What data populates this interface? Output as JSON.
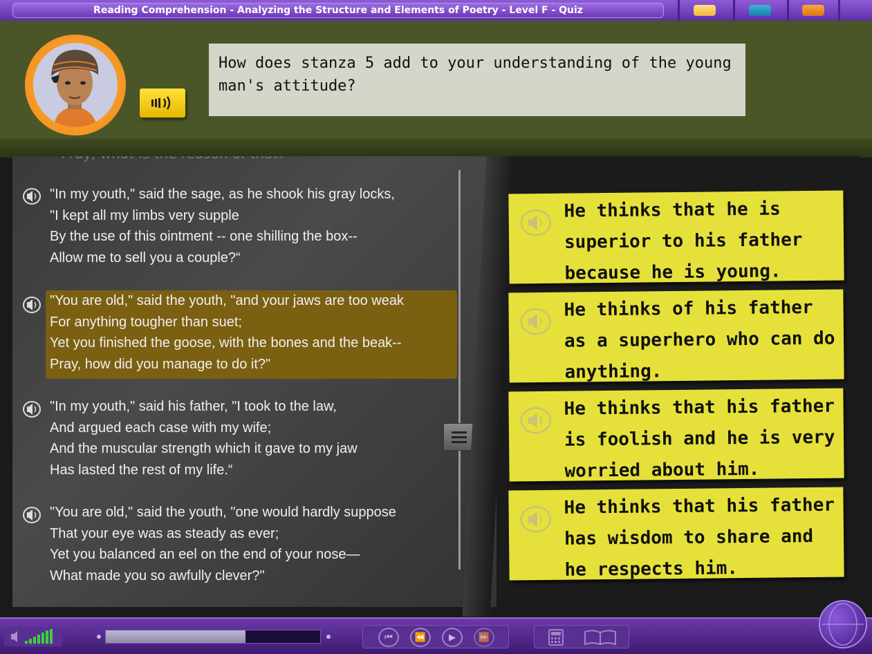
{
  "window": {
    "title": "Reading Comprehension - Analyzing the Structure and Elements of Poetry - Level  F - Quiz"
  },
  "question": {
    "text": "How does stanza 5 add to your understanding of the young man's attitude?"
  },
  "poem": {
    "faded_line": "Pray, what is the reason of that?",
    "stanzas": [
      {
        "lines": [
          "\"In my youth,\" said the sage, as he shook his gray locks,",
          "\"I kept all my limbs very supple",
          "By the use of this ointment -- one shilling the box--",
          "Allow me to sell you a couple?“"
        ],
        "highlighted": false
      },
      {
        "lines": [
          "\"You are old,\" said the youth, \"and your jaws are too weak",
          "For anything tougher than suet;",
          "Yet you finished the goose, with the bones and the beak--",
          "Pray, how did you manage to do it?\""
        ],
        "highlighted": true
      },
      {
        "lines": [
          "\"In my youth,\" said his father, \"I took to the law,",
          "And argued each case with my wife;",
          "And the muscular strength which it gave to my jaw",
          "Has lasted the rest of my life.“"
        ],
        "highlighted": false
      },
      {
        "lines": [
          "\"You are old,\" said the youth, \"one would hardly suppose",
          "That your eye was as steady as ever;",
          "Yet you balanced an eel on the end of your nose—",
          "What made you so awfully clever?\""
        ],
        "highlighted": false
      }
    ]
  },
  "answers": [
    {
      "text": "He thinks that he is superior to his father because he is young."
    },
    {
      "text": "He thinks of his father as a superhero who can do anything."
    },
    {
      "text": "He thinks that his father is foolish and he is very worried about him."
    },
    {
      "text": "He thinks that his father has wisdom to share and he respects him."
    }
  ],
  "player": {
    "progress_fraction": 0.65
  },
  "icons": {
    "speaker": "speaker-icon",
    "first": "first-icon",
    "rewind": "rewind-icon",
    "play": "play-icon",
    "forward": "forward-icon",
    "calculator": "calculator-icon",
    "book": "book-icon",
    "globe": "globe-icon"
  },
  "colors": {
    "title_bar": "#6d38b6",
    "header": "#4a5628",
    "answer_card": "#e6e13a",
    "highlight": "#7b6012",
    "avatar_ring": "#f08a12"
  }
}
